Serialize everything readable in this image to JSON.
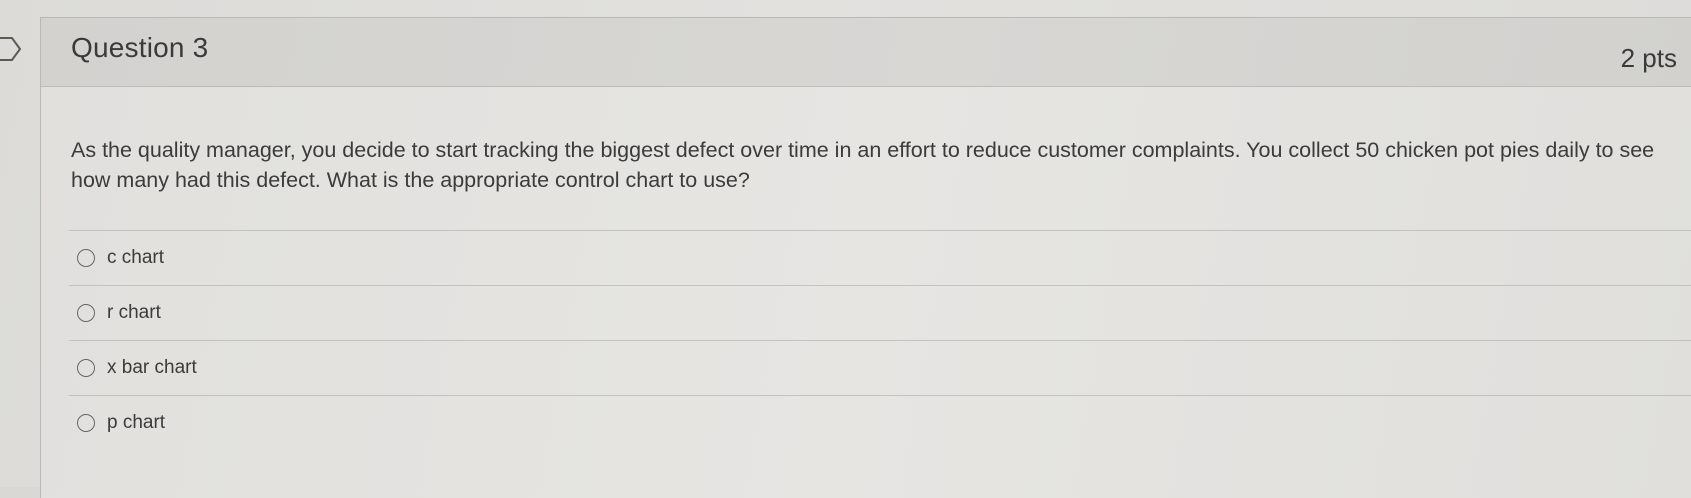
{
  "question": {
    "title": "Question 3",
    "points": "2 pts",
    "text": "As the quality manager, you decide to start tracking the biggest defect over time in an effort to reduce customer complaints.  You collect 50 chicken pot pies daily to see how many had this defect.  What is the appropriate control chart to use?",
    "answers": [
      {
        "label": "c chart",
        "selected": false
      },
      {
        "label": "r chart",
        "selected": false
      },
      {
        "label": "x bar chart",
        "selected": false
      },
      {
        "label": "p chart",
        "selected": false
      }
    ]
  },
  "icons": {
    "flag": "bookmark-flag-icon",
    "radio": "radio-button-icon"
  },
  "colors": {
    "background": "#e2e1de",
    "header": "#d6d5d2",
    "text": "#3b3b3b",
    "divider": "#c3c2bf"
  }
}
